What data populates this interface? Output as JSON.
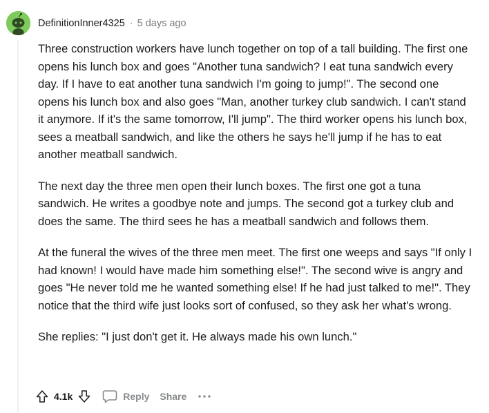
{
  "comment": {
    "username": "DefinitionInner4325",
    "separator": "·",
    "timestamp": "5 days ago",
    "avatar_color": "#7ecb5c",
    "paragraphs": [
      "Three construction workers have lunch together on top of a tall building. The first one opens his lunch box and goes \"Another tuna sandwich? I eat tuna sandwich every day. If I have to eat another tuna sandwich I'm going to jump!\". The second one opens his lunch box and also goes \"Man, another turkey club sandwich. I can't stand it anymore. If it's the same tomorrow, I'll jump\". The third worker opens his lunch box, sees a meatball sandwich, and like the others he says he'll jump if he has to eat another meatball sandwich.",
      "The next day the three men open their lunch boxes. The first one got a tuna sandwich. He writes a goodbye note and jumps. The second got a turkey club and does the same. The third sees he has a meatball sandwich and follows them.",
      "At the funeral the wives of the three men meet. The first one weeps and says \"If only I had known! I would have made him something else!\". The second wive is angry and goes \"He never told me he wanted something else! If he had just talked to me!\". They notice that the third wife just looks sort of confused, so they ask her what's wrong.",
      "She replies: \"I just don't get it. He always made his own lunch.\""
    ]
  },
  "actions": {
    "upvote_icon": "arrow-up-icon",
    "vote_count": "4.1k",
    "downvote_icon": "arrow-down-icon",
    "reply_icon": "speech-bubble-icon",
    "reply_label": "Reply",
    "share_label": "Share",
    "more_icon": "ellipsis-icon"
  }
}
